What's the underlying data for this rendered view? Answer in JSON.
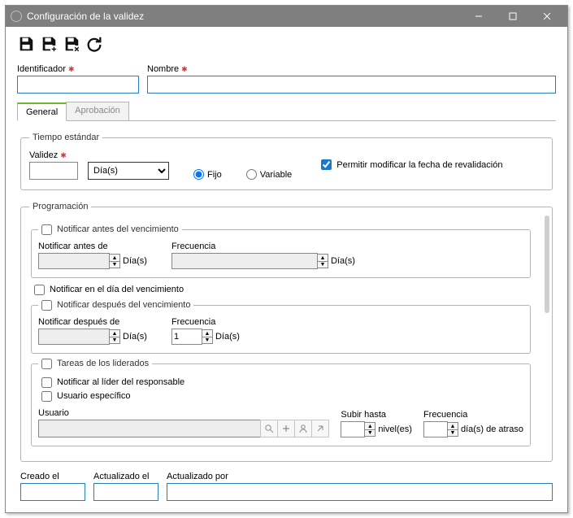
{
  "window": {
    "title": "Configuración de la validez"
  },
  "fields": {
    "identifier_label": "Identificador",
    "name_label": "Nombre"
  },
  "tabs": {
    "general": "General",
    "approval": "Aprobación"
  },
  "std": {
    "legend": "Tiempo estándar",
    "validity_label": "Validez",
    "unit": "Día(s)",
    "fixed": "Fijo",
    "variable": "Variable",
    "allow_modify": "Permitir modificar la fecha de revalidación"
  },
  "prog": {
    "legend": "Programación",
    "before_legend": "Notificar antes del vencimiento",
    "before_label": "Notificar antes de",
    "freq_label": "Frecuencia",
    "unit": "Día(s)",
    "on_day": "Notificar en el día del vencimiento",
    "after_legend": "Notificar después del vencimiento",
    "after_label": "Notificar después de",
    "after_freq_value": "1",
    "leader_legend": "Tareas de los liderados",
    "notify_leader": "Notificar al líder del responsable",
    "specific_user": "Usuario específico",
    "user_label": "Usuario",
    "up_to_label": "Subir hasta",
    "level_unit": "nivel(es)",
    "delay_unit": "día(s) de atraso"
  },
  "footer": {
    "created": "Creado el",
    "updated": "Actualizado el",
    "updated_by": "Actualizado por"
  }
}
